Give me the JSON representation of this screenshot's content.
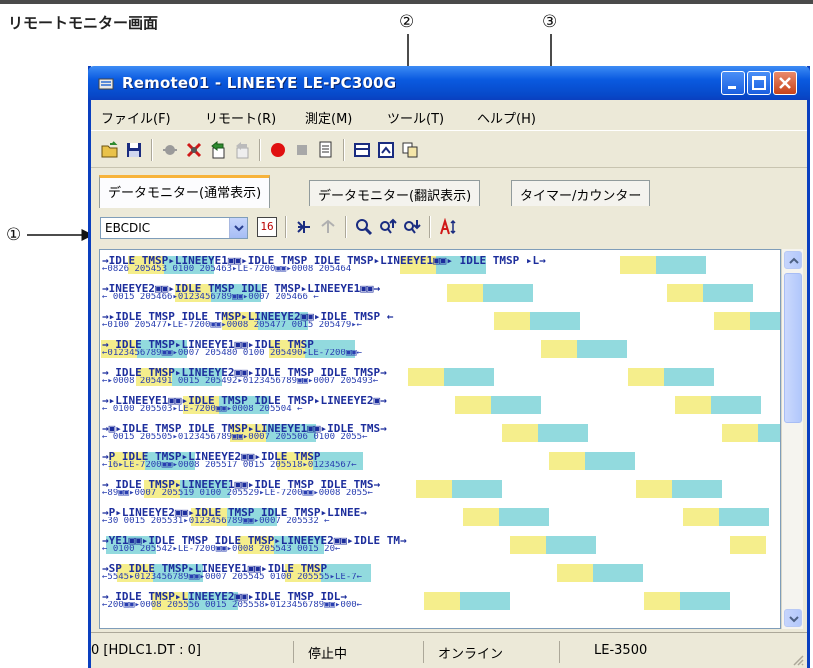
{
  "page_caption": "リモートモニター画面",
  "callouts": {
    "c1": "①",
    "c2": "②",
    "c3": "③"
  },
  "window": {
    "title": "Remote01 - LINEEYE LE-PC300G",
    "accent": "#0a5ae0",
    "close_color": "#c8431a"
  },
  "menu": [
    "ファイル(F)",
    "リモート(R)",
    "測定(M)",
    "ツール(T)",
    "ヘルプ(H)"
  ],
  "toolbar_icons": [
    "open-folder-icon",
    "save-icon",
    "record-disabled-icon",
    "delete-icon",
    "export-icon",
    "import-disabled-icon",
    "record-icon",
    "stop-icon",
    "print-preview-icon",
    "panel-icon",
    "window-icon",
    "copy-icon"
  ],
  "tabs": [
    "データモニター(通常表示)",
    "データモニター(翻訳表示)",
    "タイマー/カウンター"
  ],
  "active_tab": 0,
  "code_select": {
    "value": "EBCDIC"
  },
  "view_button": "16",
  "status": {
    "position": "0 [HDLC1.DT : 0]",
    "state": "停止中",
    "connection": "オンライン",
    "device": "LE-3500"
  },
  "colors": {
    "idle": "#f3eb78",
    "tmsp": "#7fd3d8",
    "text": "#1c2d9c",
    "data_blue": "#2a3fb0"
  },
  "monitor_rows": [
    {
      "u": "→IDLE TMSP▸LINEEYE1▣▣▸IDLE TMSP      IDLE TMSP▸LINEEYE1▣▣▸ IDLE TMSP ▸L→",
      "l": "←0826 205453              0100 205463▸LE-7200▣▣▸0008 205464"
    },
    {
      "u": "→INEEYE2▣▣▸IDLE TMSP               IDLE TMSP▸LINEEYE1▣▣→",
      "l": "←                0015 205466▸0123456789▣▣▸0007 205466       ←"
    },
    {
      "u": "→▸IDLE TMSP               IDLE TMSP▸LINEEYE2▣▣▸IDLE TMSP      ←",
      "l": "←0100 205477▸LE-7200▣▣▸0008 205477            0015 205479▸←"
    },
    {
      "u": "→             IDLE TMSP▸LINEEYE1▣▣▸IDLE TMSP",
      "l": "←0123456789▣▣▸0007 205480        0100 205490▸LE-7200▣▣←"
    },
    {
      "u": "→ IDLE TMSP▸LINEEYE2▣▣▸IDLE TMSP                  IDLE TMSP→",
      "l": "←▸0008 205491          0015 205492▸0123456789▣▣▸0007 205493←"
    },
    {
      "u": "→▸LINEEYE1▣▣▸IDLE TMSP              IDLE TMSP▸LINEEYE2▣→",
      "l": "←                0100 205503▸LE-7200▣▣▸0008 205504       ←"
    },
    {
      "u": "→▣▸IDLE TMSP               IDLE TMSP▸LINEEYE1▣▣▸IDLE TMS→",
      "l": "←  0015 205505▸0123456789▣▣▸0007 205506        0100 2055←"
    },
    {
      "u": "→P            IDLE TMSP▸LINEEYE2▣▣▸IDLE TMSP",
      "l": "←16▸LE-7200▣▣▸0008 205517        0015 205518▸01234567←"
    },
    {
      "u": "→      IDLE TMSP▸LINEEYE1▣▣▸IDLE TMSP           IDLE TMS→",
      "l": "←89▣▣▸0007 205519          0100 205529▸LE-7200▣▣▸0008 2055←"
    },
    {
      "u": "→P▸LINEEYE2▣▣▸IDLE TMSP              IDLE TMSP▸LINEE→",
      "l": "←30        0015 205531▸0123456789▣▣▸0007 205532      ←"
    },
    {
      "u": "→YE1▣▣▸IDLE TMSP              IDLE TMSP▸LINEEYE2▣▣▸IDLE TM→",
      "l": "←      0100 205542▸LE-7200▣▣▸0008 205543        0015 20←"
    },
    {
      "u": "→SP            IDLE TMSP▸LINEEYE1▣▣▸IDLE TMSP",
      "l": "←5545▸0123456789▣▣▸0007 205545          0100 205555▸LE-7←"
    },
    {
      "u": "→      IDLE TMSP▸LINEEYE2▣▣▸IDLE TMSP               IDL→",
      "l": "←200▣▣▸0008 205556         0015 205558▸0123456789▣▣▸000←"
    }
  ]
}
